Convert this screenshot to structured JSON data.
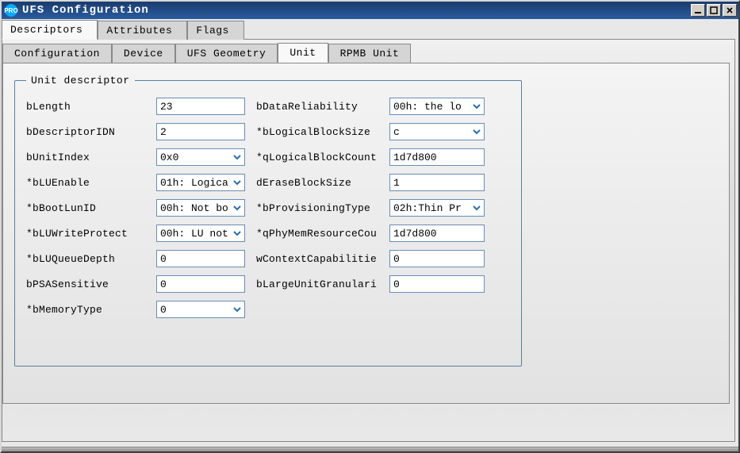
{
  "window": {
    "title": "UFS Configuration"
  },
  "tabs": {
    "main": [
      "Descriptors",
      "Attributes",
      "Flags"
    ],
    "active_main": 0,
    "sub": [
      "Configuration",
      "Device",
      "UFS Geometry",
      "Unit",
      "RPMB Unit"
    ],
    "active_sub": 3
  },
  "group": {
    "legend": "Unit descriptor"
  },
  "fields": {
    "left": [
      {
        "label": "bLength",
        "type": "text",
        "value": "23"
      },
      {
        "label": "bDescriptorIDN",
        "type": "text",
        "value": "2"
      },
      {
        "label": "bUnitIndex",
        "type": "combo",
        "value": "0x0"
      },
      {
        "label": "*bLUEnable",
        "type": "combo",
        "value": "01h: Logica"
      },
      {
        "label": "*bBootLunID",
        "type": "combo",
        "value": "00h: Not bo"
      },
      {
        "label": "*bLUWriteProtect",
        "type": "combo",
        "value": "00h: LU not"
      },
      {
        "label": "*bLUQueueDepth",
        "type": "text",
        "value": "0"
      },
      {
        "label": "bPSASensitive",
        "type": "text",
        "value": "0"
      },
      {
        "label": "*bMemoryType",
        "type": "combo",
        "value": "0"
      }
    ],
    "right": [
      {
        "label": "bDataReliability",
        "type": "combo",
        "value": "00h: the lo"
      },
      {
        "label": "*bLogicalBlockSize",
        "type": "combo",
        "value": "c"
      },
      {
        "label": "*qLogicalBlockCount",
        "type": "text",
        "value": "1d7d800"
      },
      {
        "label": "dEraseBlockSize",
        "type": "text",
        "value": "1"
      },
      {
        "label": "*bProvisioningType",
        "type": "combo",
        "value": "02h:Thin Pr"
      },
      {
        "label": "*qPhyMemResourceCou",
        "type": "text",
        "value": "1d7d800"
      },
      {
        "label": "wContextCapabilitie",
        "type": "text",
        "value": "0"
      },
      {
        "label": "bLargeUnitGranulari",
        "type": "text",
        "value": "0"
      }
    ]
  }
}
